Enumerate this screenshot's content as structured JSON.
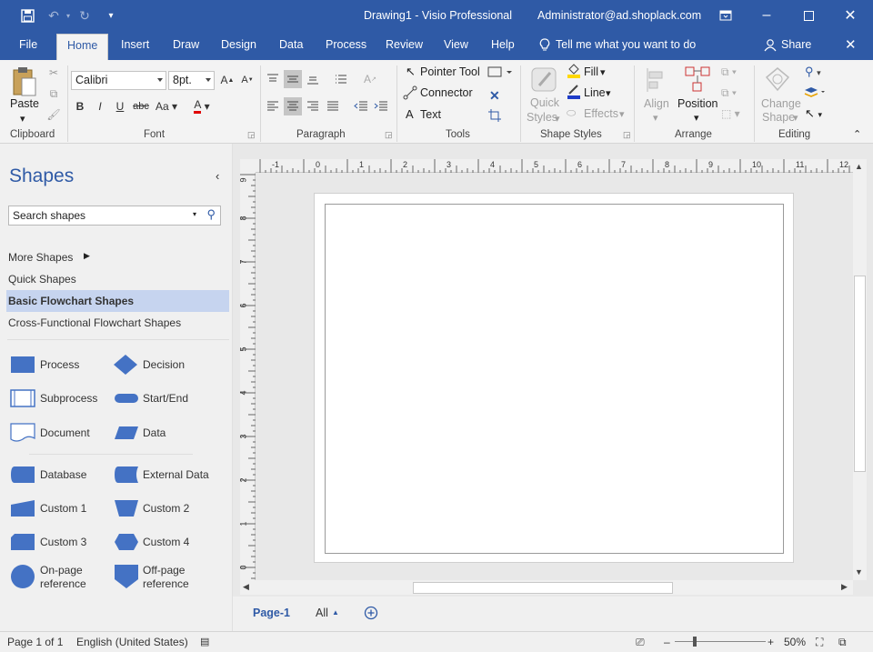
{
  "app": {
    "doc_title": "Drawing1  -  Visio Professional",
    "account": "Administrator@ad.shoplack.com"
  },
  "tabs": [
    "File",
    "Home",
    "Insert",
    "Draw",
    "Design",
    "Data",
    "Process",
    "Review",
    "View",
    "Help"
  ],
  "tell_me": "Tell me what you want to do",
  "share_label": "Share",
  "ribbon": {
    "clipboard": {
      "paste": "Paste",
      "label": "Clipboard"
    },
    "font": {
      "family": "Calibri",
      "size": "8pt.",
      "label": "Font"
    },
    "paragraph": {
      "label": "Paragraph"
    },
    "tools": {
      "pointer": "Pointer Tool",
      "connector": "Connector",
      "text": "Text",
      "label": "Tools"
    },
    "shape_styles": {
      "quick_styles_1": "Quick",
      "quick_styles_2": "Styles",
      "fill": "Fill",
      "line": "Line",
      "effects": "Effects",
      "label": "Shape Styles"
    },
    "arrange": {
      "align": "Align",
      "position": "Position",
      "label": "Arrange"
    },
    "editing": {
      "change_shape_1": "Change",
      "change_shape_2": "Shape",
      "label": "Editing"
    }
  },
  "shapes_pane": {
    "title": "Shapes",
    "search_placeholder": "Search shapes",
    "nav": [
      "More Shapes",
      "Quick Shapes",
      "Basic Flowchart Shapes",
      "Cross-Functional Flowchart Shapes"
    ],
    "stencil": [
      {
        "name": "Process"
      },
      {
        "name": "Decision"
      },
      {
        "name": "Subprocess"
      },
      {
        "name": "Start/End"
      },
      {
        "name": "Document"
      },
      {
        "name": "Data"
      },
      {
        "name": "Database"
      },
      {
        "name": "External Data"
      },
      {
        "name": "Custom 1"
      },
      {
        "name": "Custom 2"
      },
      {
        "name": "Custom 3"
      },
      {
        "name": "Custom 4"
      },
      {
        "name": "On-page\nreference"
      },
      {
        "name": "Off-page\nreference"
      }
    ]
  },
  "ruler": {
    "h": [
      "-1",
      "0",
      "1",
      "2",
      "3",
      "4",
      "5",
      "6",
      "7",
      "8",
      "9",
      "10",
      "11",
      "12"
    ],
    "v": [
      "9",
      "8",
      "7",
      "6",
      "5",
      "4",
      "3",
      "2",
      "1",
      "0"
    ]
  },
  "page_tabs": {
    "page": "Page-1",
    "all": "All"
  },
  "status": {
    "page": "Page 1 of 1",
    "language": "English (United States)",
    "zoom": "50%"
  },
  "colors": {
    "accent": "#2f5aa6",
    "shape_fill": "#4472c4"
  }
}
